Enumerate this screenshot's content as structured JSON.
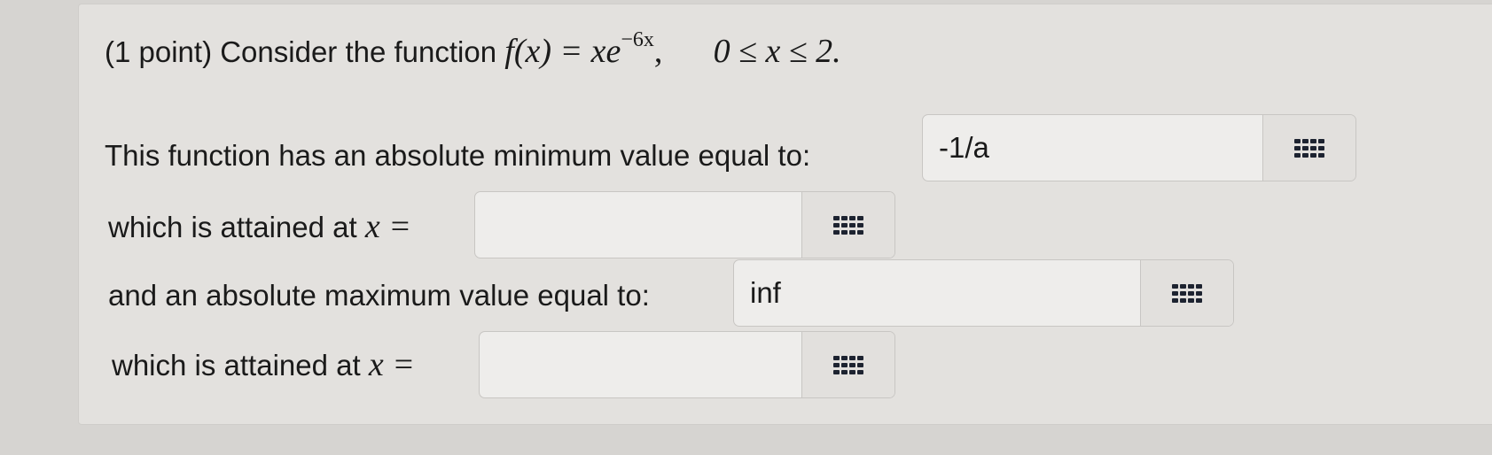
{
  "problem": {
    "prefix": "(1 point) Consider the function",
    "fx": "f(x) = xe",
    "exponent": "−6x",
    "comma": ",",
    "domain": "0 ≤ x ≤ 2."
  },
  "rows": [
    {
      "label": "This function has an absolute minimum value equal to:",
      "value": "-1/a",
      "button_icon": "grid-icon"
    },
    {
      "label": "which is attained at",
      "math": "x =",
      "value": "",
      "button_icon": "grid-icon"
    },
    {
      "label": "and an absolute maximum value equal to:",
      "value": "inf",
      "button_icon": "grid-icon"
    },
    {
      "label": "which is attained at",
      "math": "x =",
      "value": "",
      "button_icon": "grid-icon"
    }
  ]
}
